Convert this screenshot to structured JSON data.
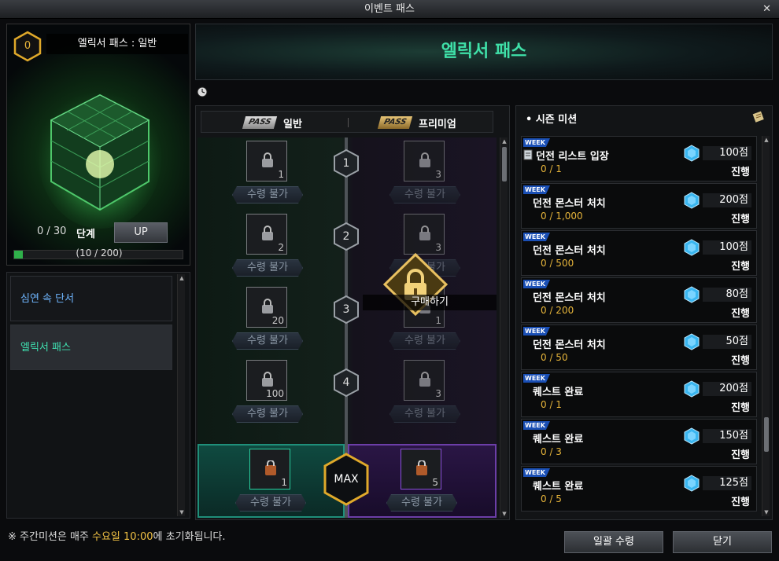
{
  "window": {
    "title": "이벤트 패스"
  },
  "pass_card": {
    "level": "0",
    "title": "엘릭서 패스 : 일반",
    "stage_count": "0 / 30",
    "stage_label": "단계",
    "up_button": "UP",
    "exp_text": "(10 / 200)",
    "exp_fraction": 0.05
  },
  "menu": {
    "items": [
      {
        "label": "심연 속 단서"
      },
      {
        "label": "엘릭서 패스"
      }
    ]
  },
  "banner": {
    "title": "엘릭서 패스"
  },
  "track": {
    "tab_normal_tag": "PASS",
    "tab_normal_label": "일반",
    "tab_premium_tag": "PASS",
    "tab_premium_label": "프리미엄",
    "claim_label": "수령 불가",
    "buy_label": "구매하기",
    "max_label": "MAX",
    "stages": [
      {
        "num": "1",
        "normal_qty": "1",
        "premium_qty": "3"
      },
      {
        "num": "2",
        "normal_qty": "2",
        "premium_qty": "3"
      },
      {
        "num": "3",
        "normal_qty": "20",
        "premium_qty": "1"
      },
      {
        "num": "4",
        "normal_qty": "100",
        "premium_qty": "3"
      }
    ],
    "max_normal_qty": "1",
    "max_premium_qty": "5"
  },
  "missions": {
    "header": "시즌 미션",
    "week_label": "WEEK",
    "items": [
      {
        "name": "던전 리스트 입장",
        "progress": "0 / 1",
        "points": "100점",
        "status": "진행"
      },
      {
        "name": "던전 몬스터 처치",
        "progress": "0 / 1,000",
        "points": "200점",
        "status": "진행"
      },
      {
        "name": "던전 몬스터 처치",
        "progress": "0 / 500",
        "points": "100점",
        "status": "진행"
      },
      {
        "name": "던전 몬스터 처치",
        "progress": "0 / 200",
        "points": "80점",
        "status": "진행"
      },
      {
        "name": "던전 몬스터 처치",
        "progress": "0 / 50",
        "points": "50점",
        "status": "진행"
      },
      {
        "name": "퀘스트 완료",
        "progress": "0 / 1",
        "points": "200점",
        "status": "진행"
      },
      {
        "name": "퀘스트 완료",
        "progress": "0 / 3",
        "points": "150점",
        "status": "진행"
      },
      {
        "name": "퀘스트 완료",
        "progress": "0 / 5",
        "points": "125점",
        "status": "진행"
      }
    ]
  },
  "footer": {
    "note_prefix": "※ 주간미션은 매주 ",
    "note_day": "수요일",
    "note_time": " 10:00",
    "note_suffix": "에 초기화됩니다.",
    "claim_all_button": "일괄 수령",
    "close_button": "닫기"
  },
  "colors": {
    "accent_green": "#3fe0a8",
    "progress_gold": "#e6b43a",
    "week_blue": "#1a4fb5"
  }
}
